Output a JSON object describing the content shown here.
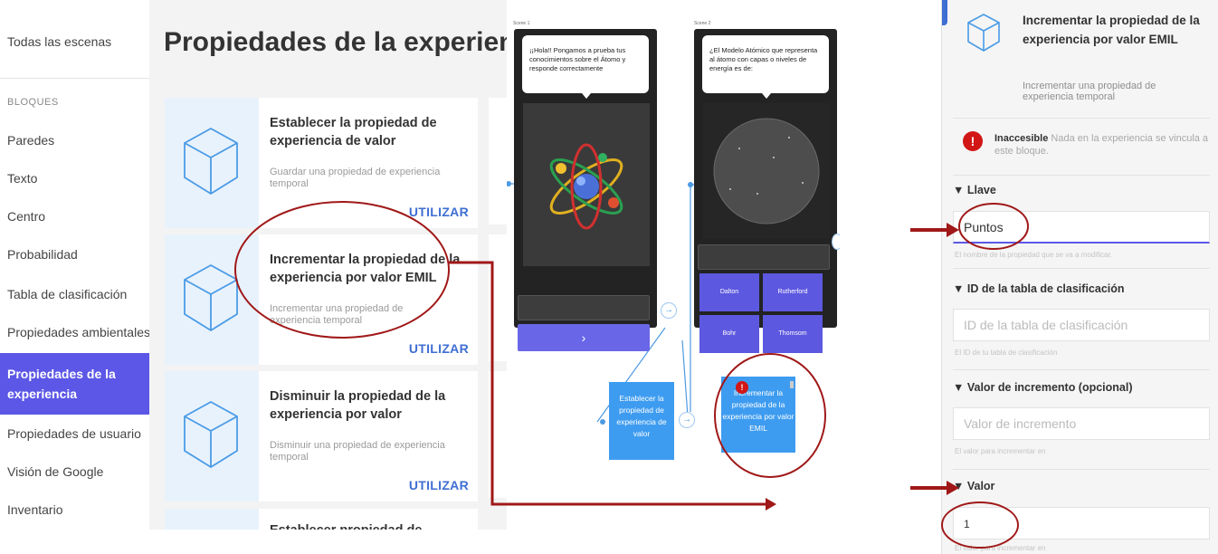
{
  "sidebar": {
    "all_scenes": "Todas las escenas",
    "section": "BLOQUES",
    "items": [
      "Paredes",
      "Texto",
      "Centro",
      "Probabilidad",
      "Tabla de clasificación",
      "Propiedades ambientales",
      "Propiedades de la experiencia",
      "Propiedades de usuario",
      "Visión de Google",
      "Inventario"
    ],
    "active_index": 6
  },
  "main": {
    "title": "Propiedades de la experiencia",
    "cards": [
      {
        "title": "Establecer la propiedad de experiencia de valor",
        "desc": "Guardar una propiedad de experiencia temporal",
        "button": "UTILIZAR"
      },
      {
        "title": "Incrementar la propiedad de la experiencia por valor EMIL",
        "desc": "Incrementar una propiedad de experiencia temporal",
        "button": "UTILIZAR"
      },
      {
        "title": "Disminuir la propiedad de la experiencia por valor",
        "desc": "Disminuir una propiedad de experiencia temporal",
        "button": "UTILIZAR"
      },
      {
        "title": "Establecer propiedad de experiencia",
        "desc": "",
        "button": ""
      }
    ]
  },
  "canvas": {
    "scene1": {
      "label": "Scene 1",
      "bubble": "¡¡Hola!! Pongamos a prueba tus conocimientos sobre el Átomo y responde correctamente",
      "next": "›"
    },
    "scene2": {
      "label": "Scene 2",
      "bubble": "¿El Modelo Atómico que representa al átomo con capas o niveles de energía es de:",
      "answers": [
        "Dalton",
        "Rutherford",
        "Bohr",
        "Thomsom"
      ]
    },
    "node_set": "Establecer la propiedad de experiencia de valor",
    "node_inc": "Incrementar la propiedad de la experiencia por valor EMIL",
    "node_badge": "!"
  },
  "panel": {
    "block_title": "Incrementar la propiedad de la experiencia por valor EMIL",
    "block_desc": "Incrementar una propiedad de experiencia temporal",
    "warning_title": "Inaccesible",
    "warning_text": "Nada en la experiencia se vincula a este bloque.",
    "key_header": "▼ Llave",
    "key_value": "Puntos",
    "key_hint": "El nombre de la propiedad que se va a modificar.",
    "lb_header": "▼ ID de la tabla de clasificación",
    "lb_placeholder": "ID de la tabla de clasificación",
    "lb_hint": "El ID de tu tabla de clasificación",
    "inc_header": "▼ Valor de incremento (opcional)",
    "inc_placeholder": "Valor de incremento",
    "inc_hint": "El valor para incrementar en",
    "val_header": "▼ Valor",
    "val_value": "1",
    "val_hint": "El valor para incrementar en"
  },
  "colors": {
    "accent": "#5c57e6",
    "link": "#3f6ed3",
    "node": "#3e9cf0",
    "annotation": "#a01818"
  }
}
